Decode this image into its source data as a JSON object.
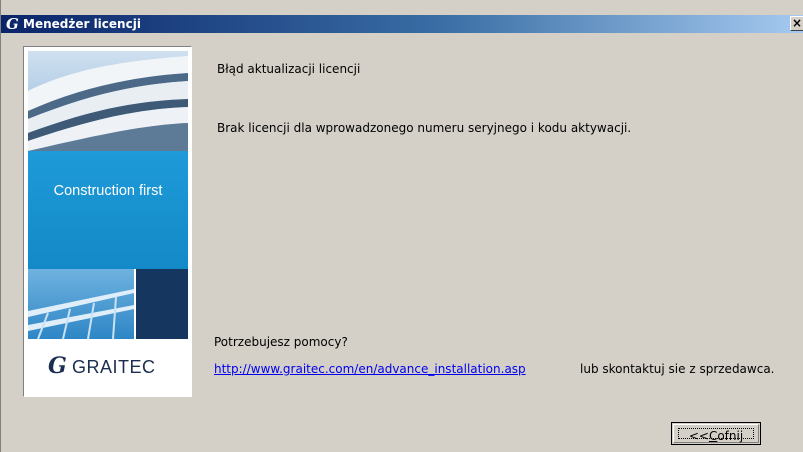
{
  "window": {
    "title_logo": "G",
    "title": "Menedżer licencji",
    "close_label": "×"
  },
  "side_panel": {
    "band_text": "Construction first",
    "logo_mark": "G",
    "logo_word": "GRAITEC"
  },
  "main": {
    "heading": "Błąd aktualizacji licencji",
    "message": "Brak licencji dla wprowadzonego numeru seryjnego i kodu aktywacji.",
    "help_label": "Potrzebujesz pomocy?",
    "help_link": "http://www.graitec.com/en/advance_installation.asp",
    "contact_text": "lub skontaktuj sie z sprzedawca."
  },
  "buttons": {
    "back_prefix": "<<",
    "back_accel": "C",
    "back_rest": "ofnij"
  },
  "colors": {
    "title_start": "#0a246a",
    "title_end": "#a6caf0",
    "band_blue": "#1e9ad8",
    "navy": "#15375f",
    "dialog_bg": "#d4d0c8"
  }
}
